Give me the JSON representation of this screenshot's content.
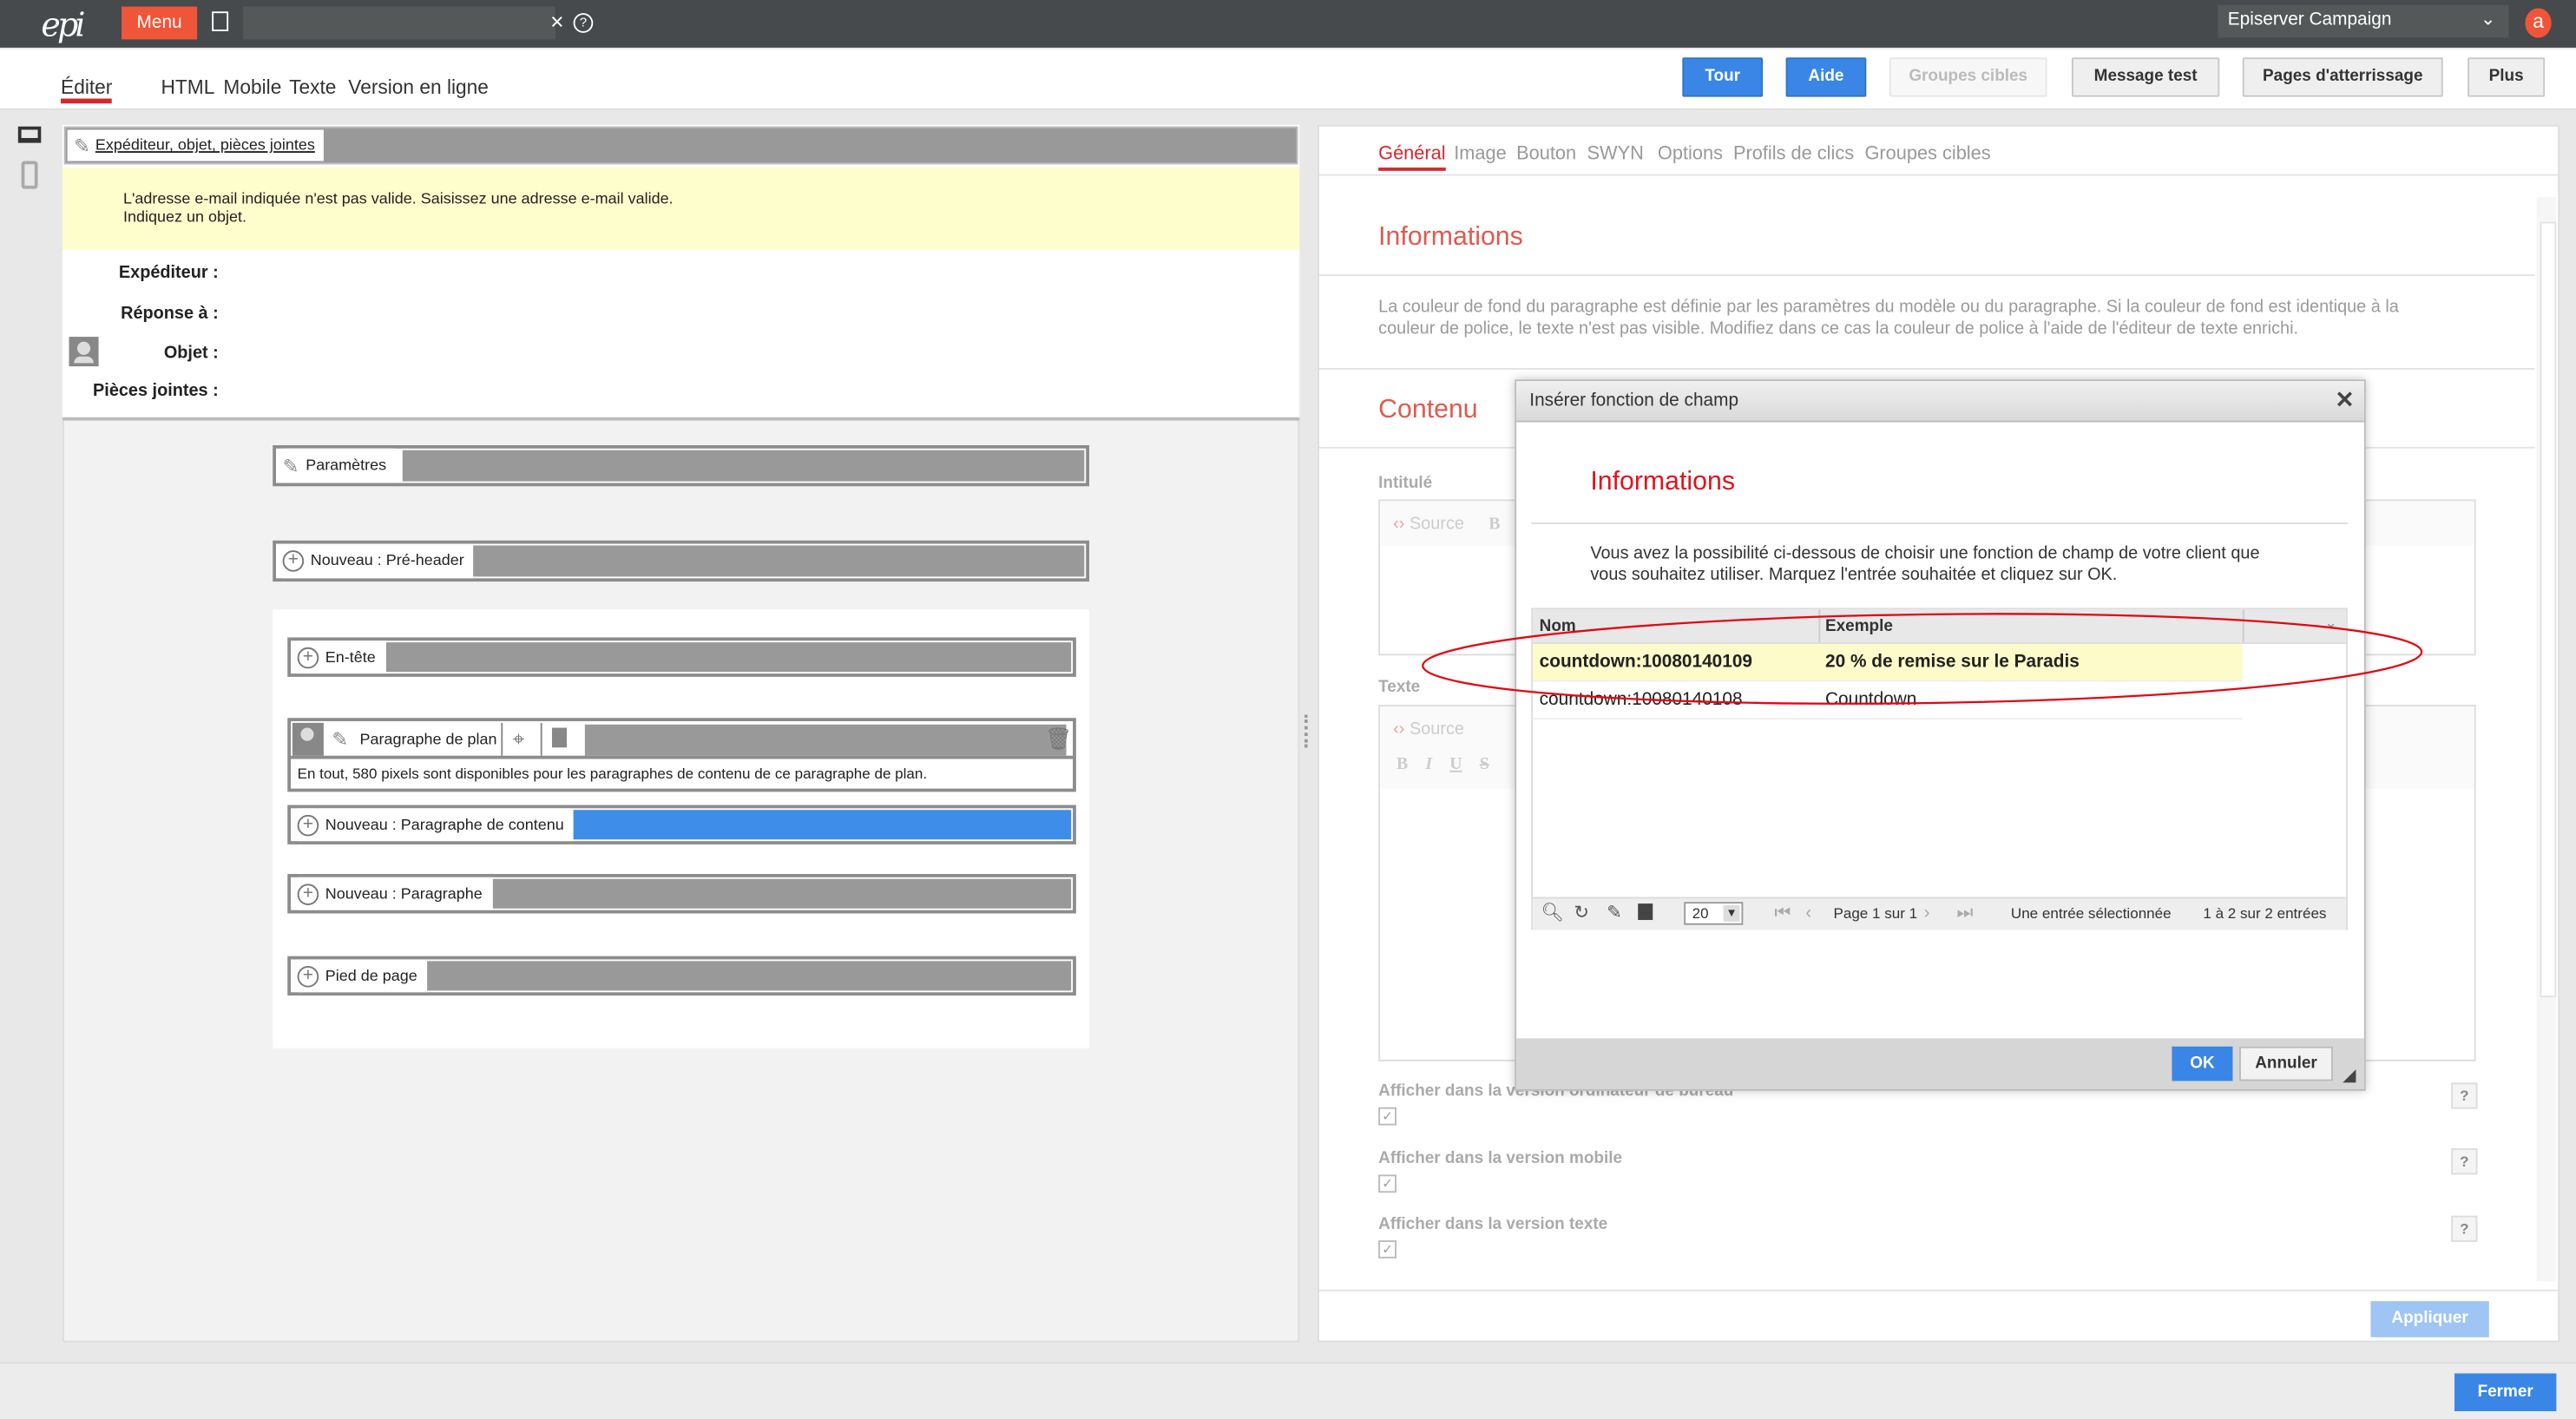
{
  "topbar": {
    "logo": "epi",
    "menu_label": "Menu",
    "clear_icon": "×",
    "help_icon": "?",
    "brand_select": "Episerver Campaign",
    "avatar_letter": "a"
  },
  "tabs": [
    "Éditer",
    "HTML",
    "Mobile",
    "Texte",
    "Version en ligne"
  ],
  "toolbar": {
    "tour": "Tour",
    "aide": "Aide",
    "groupes_cibles": "Groupes cibles",
    "message_test": "Message test",
    "pages": "Pages d'atterrissage",
    "plus": "Plus"
  },
  "left": {
    "header_link": "Expéditeur, objet, pièces jointes",
    "warnings": [
      "L'adresse e-mail indiquée n'est pas valide. Saisissez une adresse e-mail valide.",
      "Indiquez un objet."
    ],
    "fields": [
      "Expéditeur :",
      "Réponse à :",
      "Objet :",
      "Pièces jointes :"
    ],
    "blocks": {
      "parametres": "Paramètres",
      "preheader": "Nouveau : Pré-header",
      "entete": "En-tête",
      "plan": "Paragraphe de plan",
      "plan_info": "En tout, 580 pixels sont disponibles pour les paragraphes de contenu de ce paragraphe de plan.",
      "contenu": "Nouveau : Paragraphe de contenu",
      "paragraphe": "Nouveau : Paragraphe",
      "pied": "Pied de page"
    }
  },
  "right": {
    "tabs": [
      "Général",
      "Image",
      "Bouton",
      "SWYN",
      "Options",
      "Profils de clics",
      "Groupes cibles"
    ],
    "info_heading": "Informations",
    "info_text": "La couleur de fond du paragraphe est définie par les paramètres du modèle ou du paragraphe. Si la couleur de fond est identique à la couleur de police, le texte n'est pas visible. Modifiez dans ce cas la couleur de police à l'aide de l'éditeur de texte enrichi.",
    "contenu_heading": "Contenu",
    "intitule_label": "Intitulé",
    "texte_label": "Texte",
    "source_label": "Source",
    "checkboxes": [
      {
        "label": "Afficher dans la version ordinateur de bureau",
        "checked": true
      },
      {
        "label": "Afficher dans la version mobile",
        "checked": true
      },
      {
        "label": "Afficher dans la version texte",
        "checked": true
      }
    ],
    "help": "?",
    "apply": "Appliquer"
  },
  "dialog": {
    "title": "Insérer fonction de champ",
    "heading": "Informations",
    "text": "Vous avez la possibilité ci-dessous de choisir une fonction de champ de votre client que vous souhaitez utiliser. Marquez l'entrée souhaitée et cliquez sur OK.",
    "columns": [
      "Nom",
      "Exemple"
    ],
    "rows": [
      {
        "nom": "countdown:10080140109",
        "exemple": "20 % de remise sur le Paradis",
        "selected": true
      },
      {
        "nom": "countdown:10080140108",
        "exemple": "Countdown",
        "selected": false
      }
    ],
    "page_size": "20",
    "page_info": "Page 1 sur 1",
    "selection_info": "Une entrée sélectionnée",
    "count_info": "1 à 2 sur 2 entrées",
    "ok": "OK",
    "cancel": "Annuler"
  },
  "footer": {
    "close": "Fermer"
  },
  "colors": {
    "accent_red": "#d8262e",
    "primary_blue": "#3a86e6",
    "warning_bg": "#fefdcc",
    "selected_row": "#fdfbc9",
    "annotation": "#e30613"
  }
}
